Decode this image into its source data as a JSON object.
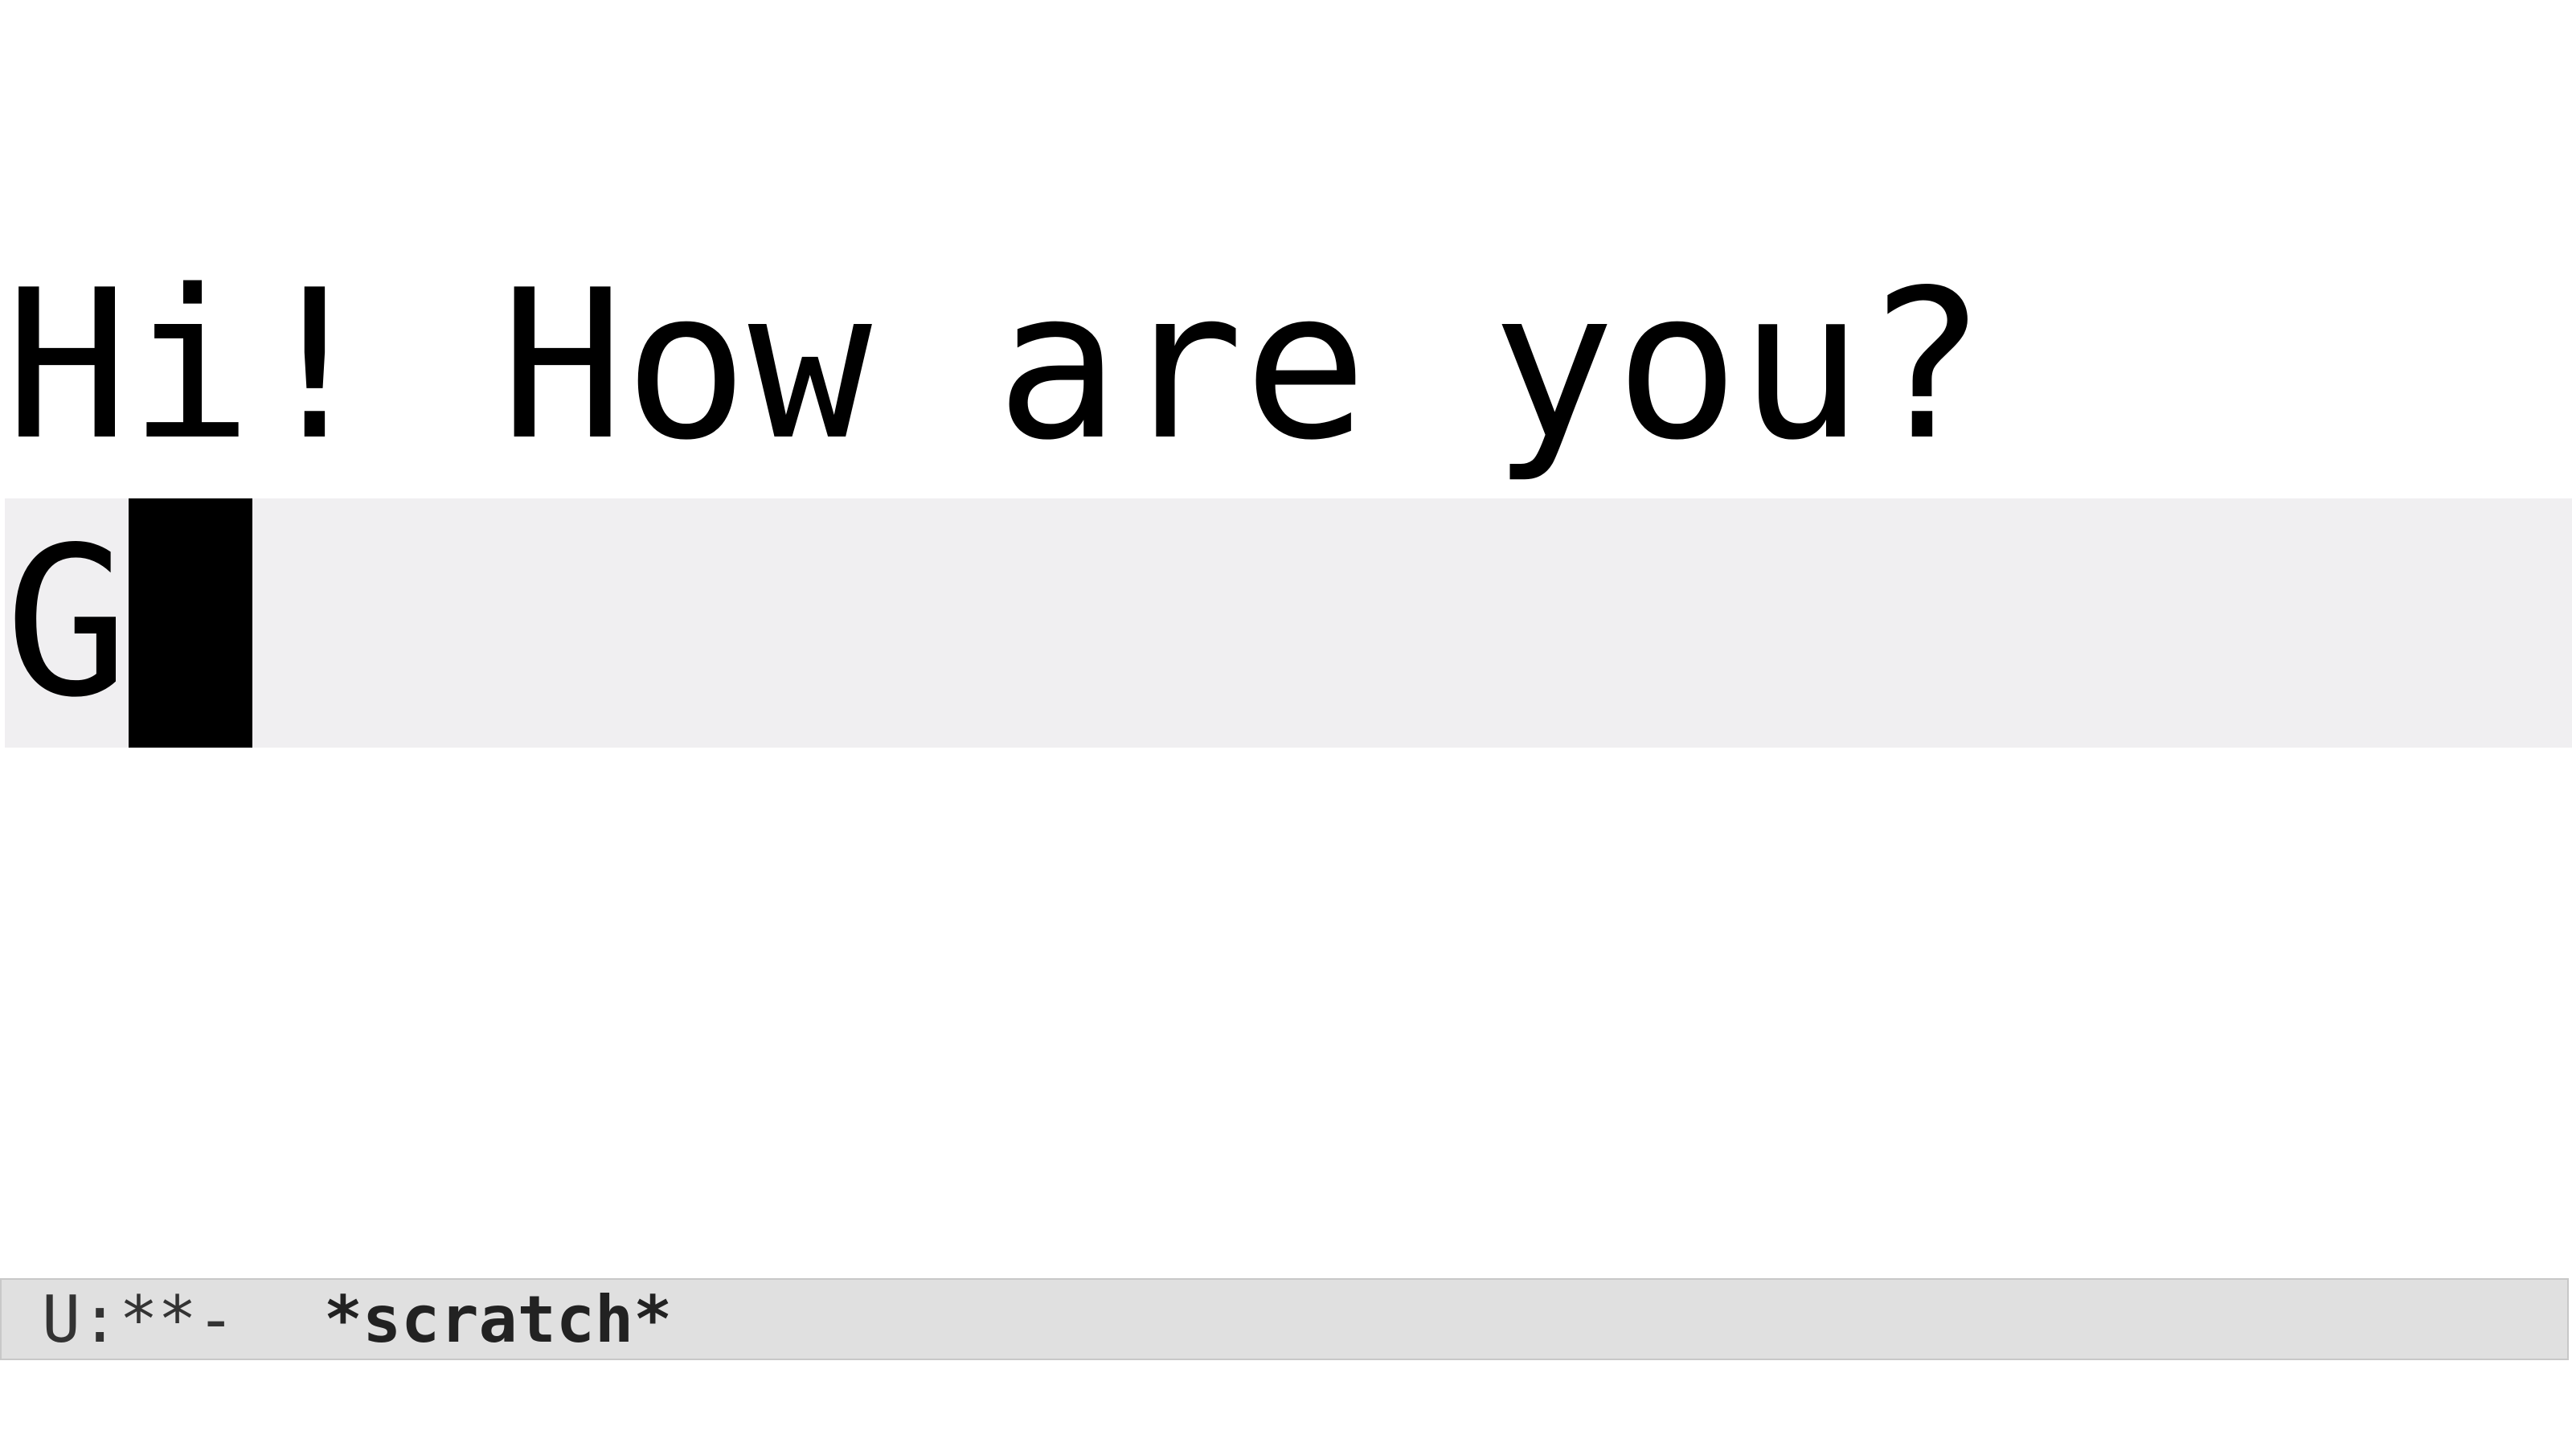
{
  "buffer": {
    "lines": [
      "Hi! How are you?",
      "G"
    ]
  },
  "modeline": {
    "status": "U:**-",
    "buffer_name": "*scratch*"
  },
  "colors": {
    "background": "#ffffff",
    "current_line_highlight": "#f0eff1",
    "cursor": "#000000",
    "modeline_background": "#e0e0e0"
  }
}
